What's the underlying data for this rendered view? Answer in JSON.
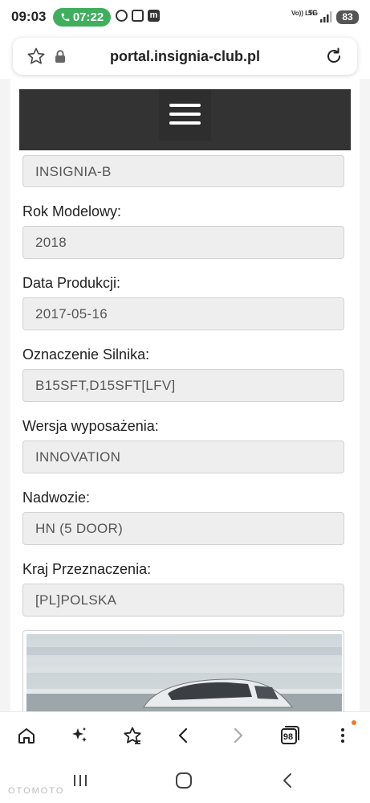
{
  "status_bar": {
    "time": "09:03",
    "call_timer": "07:22",
    "network": "5G",
    "volte": "Vo)) LTE",
    "battery": "83"
  },
  "browser": {
    "url": "portal.insignia-club.pl",
    "tab_count": "98"
  },
  "form": {
    "model_value": "INSIGNIA-B",
    "fields": [
      {
        "label": "Rok Modelowy:",
        "value": "2018"
      },
      {
        "label": "Data Produkcji:",
        "value": "2017-05-16"
      },
      {
        "label": "Oznaczenie Silnika:",
        "value": "B15SFT,D15SFT[LFV]"
      },
      {
        "label": "Wersja wyposażenia:",
        "value": "INNOVATION"
      },
      {
        "label": "Nadwozie:",
        "value": "HN (5 DOOR)"
      },
      {
        "label": "Kraj Przeznaczenia:",
        "value": "[PL]POLSKA"
      }
    ]
  },
  "watermark": "OTOMOTO",
  "colors": {
    "call_pill": "#3fae5d",
    "navbar": "#333333",
    "field_bg": "#eeeeee",
    "notification_dot": "#f07a2a"
  }
}
